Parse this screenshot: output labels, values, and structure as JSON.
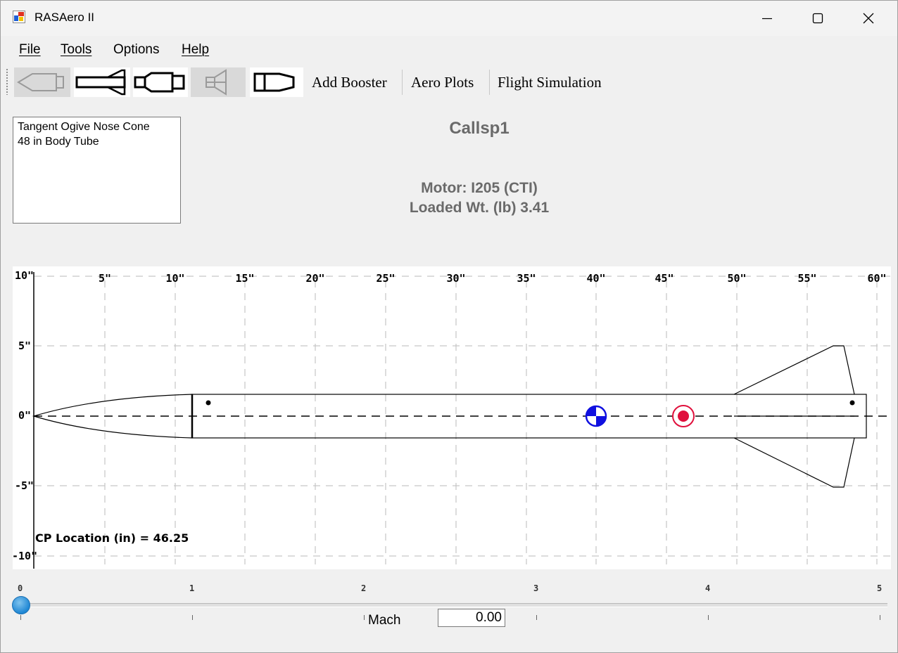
{
  "window": {
    "title": "RASAero II"
  },
  "menu": {
    "file": "File",
    "tools": "Tools",
    "options": "Options",
    "help": "Help"
  },
  "toolbar": {
    "add_booster": "Add Booster",
    "aero_plots": "Aero Plots",
    "flight_simulation": "Flight Simulation"
  },
  "components": [
    "Tangent Ogive Nose Cone",
    "48 in Body Tube"
  ],
  "rocket": {
    "name": "Callsp1",
    "motor": "Motor: I205  (CTI)",
    "loaded_weight": "Loaded Wt. (lb) 3.41"
  },
  "plot": {
    "x_ticks": [
      "5\"",
      "10\"",
      "15\"",
      "20\"",
      "25\"",
      "30\"",
      "35\"",
      "40\"",
      "45\"",
      "50\"",
      "55\"",
      "60\""
    ],
    "y_ticks": [
      "10\"",
      "5\"",
      "0\"",
      "-5\"",
      "-10\""
    ],
    "cp_label": "CP Location (in) = 46.25",
    "cg_color": "#1010e0",
    "cp_color": "#e0103c"
  },
  "mach": {
    "ticks": [
      "0",
      "1",
      "2",
      "3",
      "4",
      "5"
    ],
    "label": "Mach",
    "value": "0.00",
    "slider_position": 0
  }
}
